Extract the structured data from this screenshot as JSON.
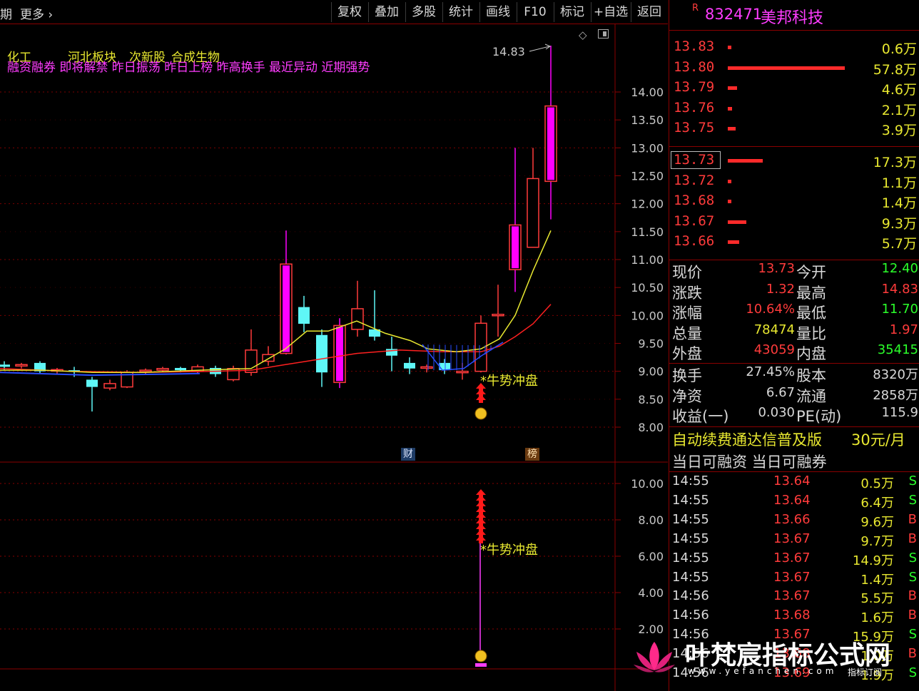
{
  "toolbar": {
    "left_cut": "期",
    "more": "更多",
    "buttons": [
      "复权",
      "叠加",
      "多股",
      "统计",
      "画线",
      "F10",
      "标记",
      "+自选",
      "返回"
    ]
  },
  "chart": {
    "tags_line1": [
      "化工",
      "河北板块",
      "次新股",
      "合成生物"
    ],
    "tags_line2": "融资融券 即将解禁 昨日振荡 昨日上榜 昨高换手 最近异动 近期强势",
    "high_marker": "14.83",
    "signal_text": "*牛势冲盘",
    "cai_badge": "财",
    "bang_badge": "榜",
    "price_axis": [
      "14.00",
      "13.50",
      "13.00",
      "12.50",
      "12.00",
      "11.50",
      "11.00",
      "10.50",
      "10.00",
      "9.50",
      "9.00",
      "8.50",
      "8.00"
    ],
    "lower_axis": [
      "10.00",
      "8.00",
      "6.00",
      "4.00",
      "2.00"
    ],
    "lower_signal_text": "*牛势冲盘",
    "colors": {
      "up": "#ff3b3b",
      "down": "#5ff7f7",
      "signal": "#ff00ff",
      "ma5": "#e8e830",
      "ma10": "#ff2020",
      "grid": "#8a0000"
    }
  },
  "quote": {
    "r_mark": "R",
    "code": "832471",
    "name": "美邦科技",
    "asks": [
      {
        "price": "13.83",
        "vol": "0.6万",
        "bar": 0.6
      },
      {
        "price": "13.80",
        "vol": "57.8万",
        "bar": 57.8
      },
      {
        "price": "13.79",
        "vol": "4.6万",
        "bar": 4.6
      },
      {
        "price": "13.76",
        "vol": "2.1万",
        "bar": 2.1
      },
      {
        "price": "13.75",
        "vol": "3.9万",
        "bar": 3.9
      }
    ],
    "bids": [
      {
        "price": "13.73",
        "vol": "17.3万",
        "bar": 17.3
      },
      {
        "price": "13.72",
        "vol": "1.1万",
        "bar": 1.1
      },
      {
        "price": "13.68",
        "vol": "1.4万",
        "bar": 1.4
      },
      {
        "price": "13.67",
        "vol": "9.3万",
        "bar": 9.3
      },
      {
        "price": "13.66",
        "vol": "5.7万",
        "bar": 5.7
      }
    ],
    "stats": [
      {
        "l1": "现价",
        "v1": "13.73",
        "c1": "#ff3b3b",
        "l2": "今开",
        "v2": "12.40",
        "c2": "#2bff2b"
      },
      {
        "l1": "涨跌",
        "v1": "1.32",
        "c1": "#ff3b3b",
        "l2": "最高",
        "v2": "14.83",
        "c2": "#ff3b3b"
      },
      {
        "l1": "涨幅",
        "v1": "10.64%",
        "c1": "#ff3b3b",
        "l2": "最低",
        "v2": "11.70",
        "c2": "#2bff2b"
      },
      {
        "l1": "总量",
        "v1": "78474",
        "c1": "#e8e830",
        "l2": "量比",
        "v2": "1.97",
        "c2": "#ff3b3b"
      },
      {
        "l1": "外盘",
        "v1": "43059",
        "c1": "#ff3b3b",
        "l2": "内盘",
        "v2": "35415",
        "c2": "#2bff2b"
      }
    ],
    "stats2": [
      {
        "l1": "换手",
        "v1": "27.45%",
        "l2": "股本",
        "v2": "8320万"
      },
      {
        "l1": "净资",
        "v1": "6.67",
        "l2": "流通",
        "v2": "2858万"
      },
      {
        "l1": "收益(一)",
        "v1": "0.030",
        "l2": "PE(动)",
        "v2": "115.9"
      }
    ],
    "promo": "自动续费通达信普及版",
    "promo_price": "30元/月",
    "margin_line": "当日可融资 当日可融券",
    "trades": [
      {
        "time": "14:55",
        "price": "13.64",
        "vol": "0.5万",
        "side": "S"
      },
      {
        "time": "14:55",
        "price": "13.64",
        "vol": "6.4万",
        "side": "S"
      },
      {
        "time": "14:55",
        "price": "13.66",
        "vol": "9.6万",
        "side": "B"
      },
      {
        "time": "14:55",
        "price": "13.67",
        "vol": "9.7万",
        "side": "B"
      },
      {
        "time": "14:55",
        "price": "13.67",
        "vol": "14.9万",
        "side": "S"
      },
      {
        "time": "14:55",
        "price": "13.67",
        "vol": "1.4万",
        "side": "S"
      },
      {
        "time": "14:56",
        "price": "13.67",
        "vol": "5.5万",
        "side": "B"
      },
      {
        "time": "14:56",
        "price": "13.68",
        "vol": "1.6万",
        "side": "B"
      },
      {
        "time": "14:56",
        "price": "13.67",
        "vol": "15.9万",
        "side": "S"
      },
      {
        "time": "14:56",
        "price": "13.68",
        "vol": "1.0万",
        "side": "B"
      },
      {
        "time": "14:56",
        "price": "13.69",
        "vol": "1.9万",
        "side": "S"
      }
    ]
  },
  "watermark": {
    "title": "叶梵宸指标公式网",
    "url": "www.yefanchen.com",
    "sub": "指标订阅"
  }
}
